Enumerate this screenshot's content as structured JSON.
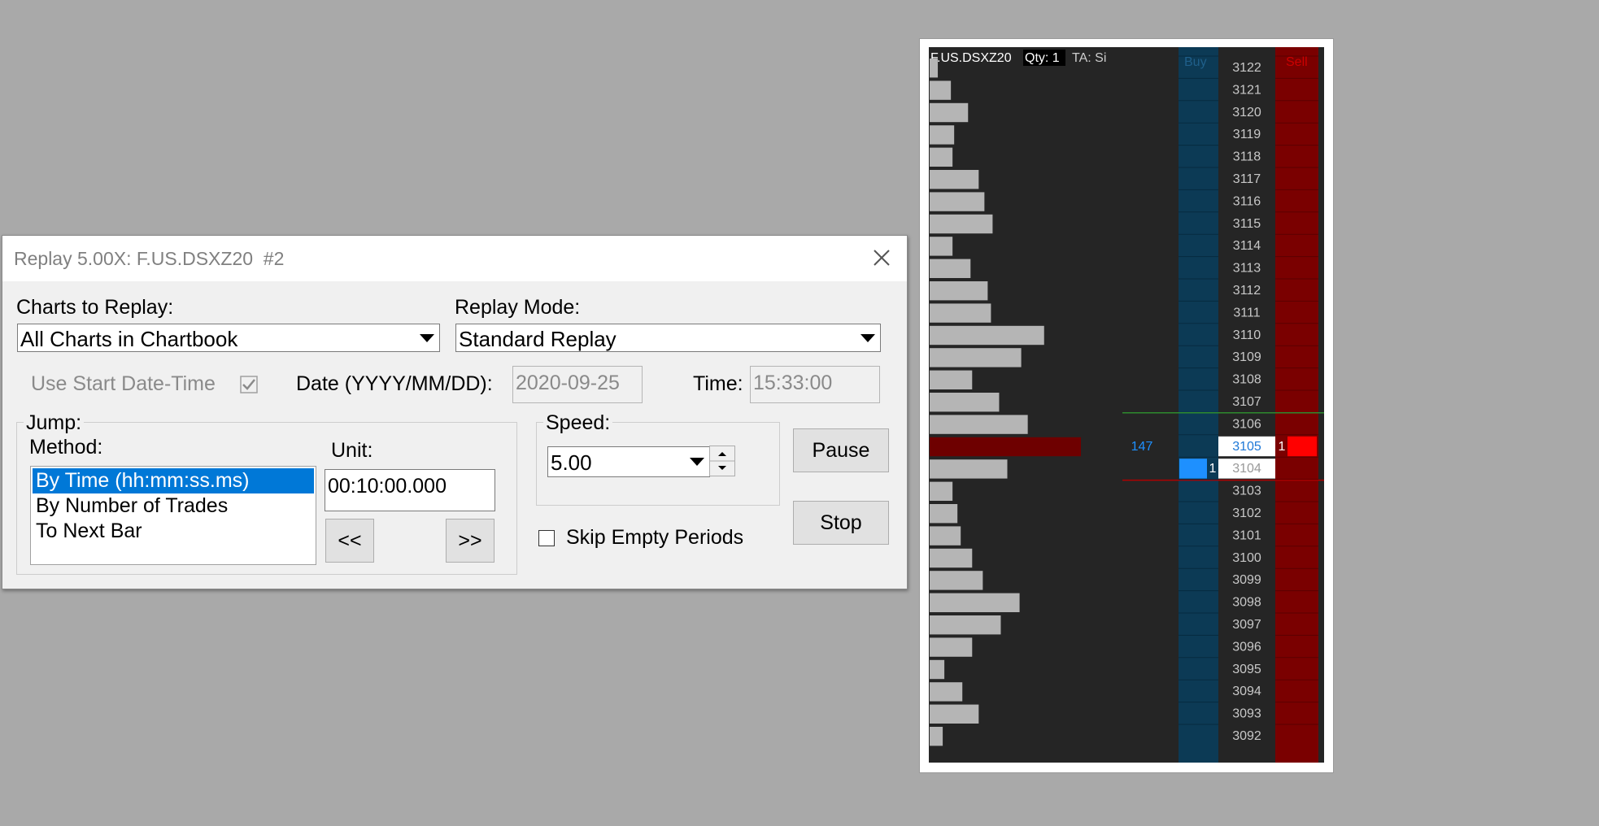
{
  "dialog": {
    "title": "Replay 5.00X: F.US.DSXZ20  #2",
    "charts_label": "Charts to Replay:",
    "charts_value": "All Charts in Chartbook",
    "mode_label": "Replay Mode:",
    "mode_value": "Standard Replay",
    "use_start_label": "Use Start Date-Time",
    "use_start_checked": true,
    "date_label": "Date (YYYY/MM/DD):",
    "date_value": "2020-09-25",
    "time_label": "Time:",
    "time_value": "15:33:00",
    "jump_label": "Jump:",
    "method_label": "Method:",
    "methods": [
      "By Time (hh:mm:ss.ms)",
      "By Number of Trades",
      "To Next Bar"
    ],
    "selected_method": 0,
    "unit_label": "Unit:",
    "unit_value": "00:10:00.000",
    "back_button": "<<",
    "forward_button": ">>",
    "speed_label": "Speed:",
    "speed_value": "5.00",
    "skip_label": "Skip Empty Periods",
    "skip_checked": false,
    "pause_button": "Pause",
    "stop_button": "Stop"
  },
  "dom": {
    "symbol": "F.US.DSXZ20",
    "qty_text": "Qty: 1",
    "ta_text": "TA: Si",
    "buy_header": "Buy",
    "sell_header": "Sell",
    "prices": [
      "3122",
      "3121",
      "3120",
      "3119",
      "3118",
      "3117",
      "3116",
      "3115",
      "3114",
      "3113",
      "3112",
      "3111",
      "3110",
      "3109",
      "3108",
      "3107",
      "3106",
      "3105",
      "3104",
      "3103",
      "3102",
      "3101",
      "3100",
      "3099",
      "3098",
      "3097",
      "3096",
      "3095",
      "3094",
      "3093",
      "3092"
    ],
    "volume_profile": [
      10,
      26,
      47,
      30,
      28,
      60,
      67,
      77,
      28,
      50,
      71,
      75,
      140,
      112,
      52,
      85,
      120,
      185,
      95,
      28,
      34,
      38,
      52,
      65,
      110,
      87,
      52,
      18,
      40,
      60,
      16
    ],
    "volume_max": 185,
    "last_price": "3105",
    "last_volume": "147",
    "bid_price": "3104",
    "bid_size": "1",
    "ask_size": "1",
    "colors": {
      "background": "#252525",
      "buy_column": "#0c3a55",
      "sell_column": "#7a0000",
      "profile_bar": "#b5b5b5",
      "highlight_bar": "#6e0000",
      "bid_marker": "#1e90ff",
      "ask_marker": "#ff0000",
      "price_text": "#c8c8c8",
      "high_line": "#2e8b2e",
      "low_line": "#b00000"
    }
  }
}
